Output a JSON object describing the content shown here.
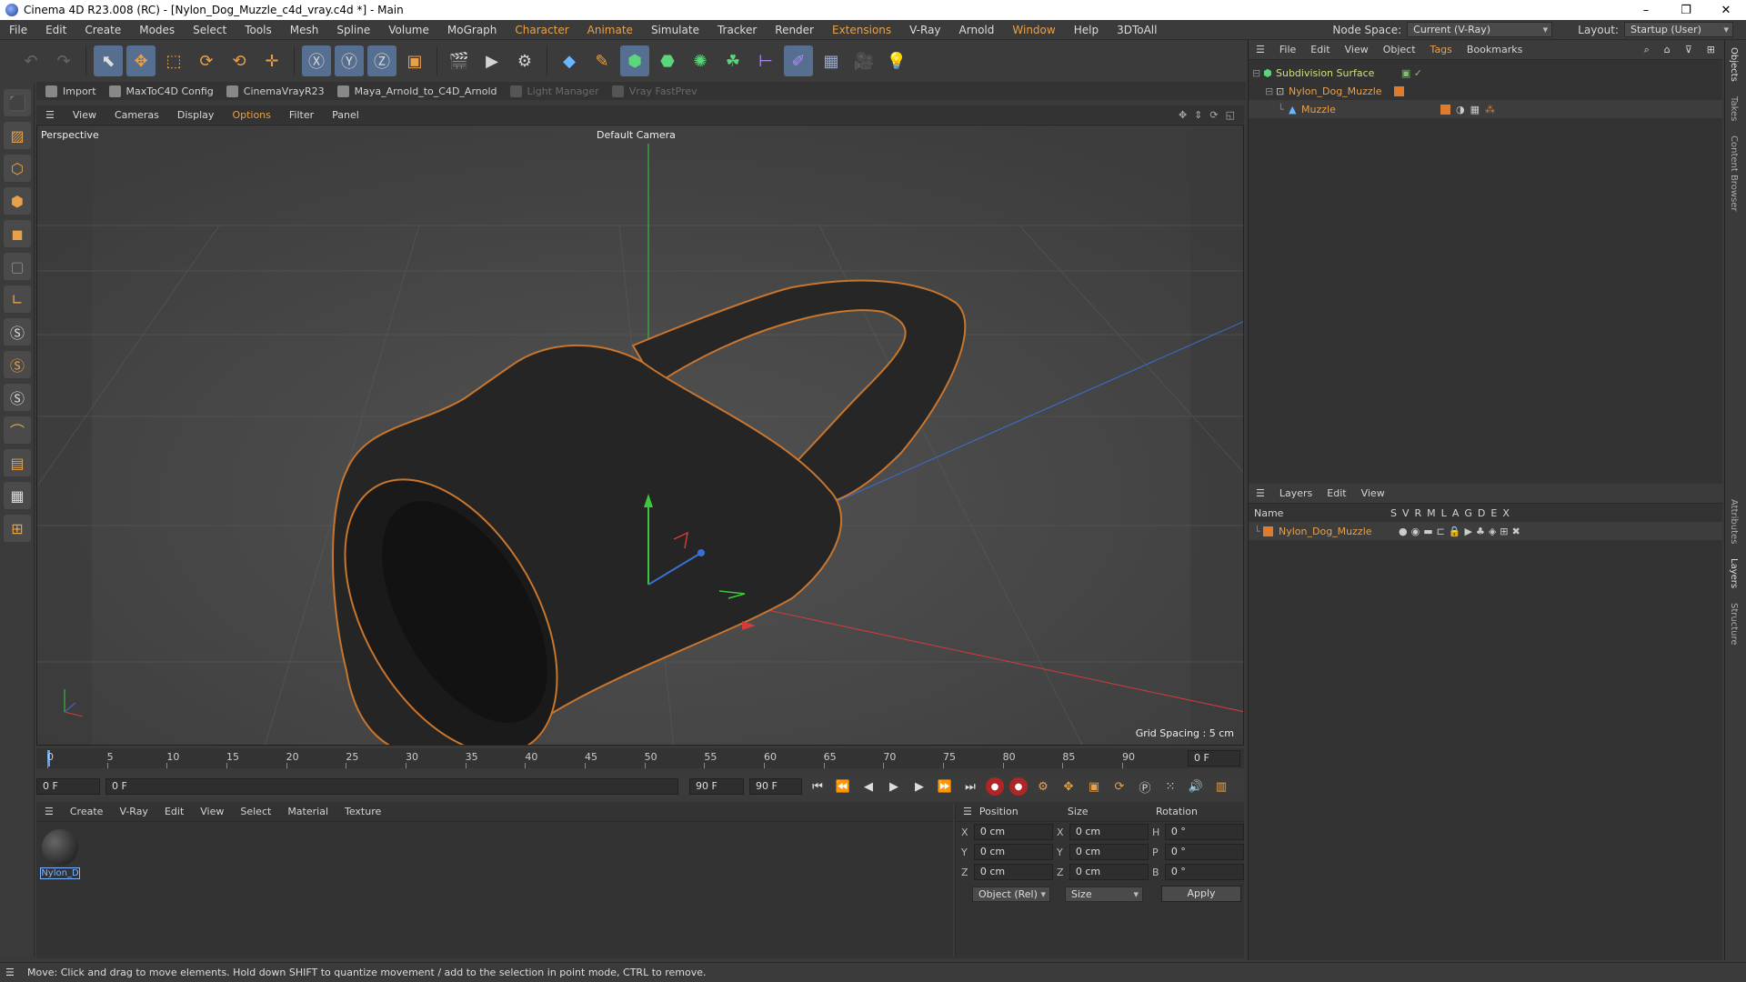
{
  "titlebar": {
    "title": "Cinema 4D R23.008 (RC) - [Nylon_Dog_Muzzle_c4d_vray.c4d *] - Main",
    "minimize": "–",
    "maximize": "❐",
    "close": "✕"
  },
  "menubar": {
    "items": [
      "File",
      "Edit",
      "Create",
      "Modes",
      "Select",
      "Tools",
      "Mesh",
      "Spline",
      "Volume",
      "MoGraph",
      "Character",
      "Animate",
      "Simulate",
      "Tracker",
      "Render",
      "Extensions",
      "V-Ray",
      "Arnold",
      "Window",
      "Help",
      "3DToAll"
    ],
    "node_space_label": "Node Space:",
    "node_space_value": "Current (V-Ray)",
    "layout_label": "Layout:",
    "layout_value": "Startup (User)"
  },
  "subbar": {
    "items": [
      "Import",
      "MaxToC4D Config",
      "CinemaVrayR23",
      "Maya_Arnold_to_C4D_Arnold",
      "Light Manager",
      "Vray FastPrev"
    ]
  },
  "viewport_menu": {
    "items": [
      "View",
      "Cameras",
      "Display",
      "Options",
      "Filter",
      "Panel"
    ]
  },
  "viewport": {
    "label": "Perspective",
    "camera": "Default Camera",
    "grid_spacing": "Grid Spacing : 5 cm"
  },
  "timeline": {
    "ticks": [
      "0",
      "5",
      "10",
      "15",
      "20",
      "25",
      "30",
      "35",
      "40",
      "45",
      "50",
      "55",
      "60",
      "65",
      "70",
      "75",
      "80",
      "85",
      "90"
    ],
    "end_field": "0 F"
  },
  "playbar": {
    "start": "0 F",
    "current": "0 F",
    "end": "90 F",
    "end2": "90 F"
  },
  "material_panel": {
    "menu": [
      "Create",
      "V-Ray",
      "Edit",
      "View",
      "Select",
      "Material",
      "Texture"
    ],
    "material_name": "Nylon_D"
  },
  "coords": {
    "headers": [
      "Position",
      "Size",
      "Rotation"
    ],
    "rows": [
      {
        "axis": "X",
        "pos": "0 cm",
        "size_axis": "X",
        "size": "0 cm",
        "rot_axis": "H",
        "rot": "0 °"
      },
      {
        "axis": "Y",
        "pos": "0 cm",
        "size_axis": "Y",
        "size": "0 cm",
        "rot_axis": "P",
        "rot": "0 °"
      },
      {
        "axis": "Z",
        "pos": "0 cm",
        "size_axis": "Z",
        "size": "0 cm",
        "rot_axis": "B",
        "rot": "0 °"
      }
    ],
    "mode": "Object (Rel)",
    "size_mode": "Size",
    "apply": "Apply"
  },
  "objects_panel": {
    "menu": [
      "File",
      "Edit",
      "View",
      "Object",
      "Tags",
      "Bookmarks"
    ],
    "tree": [
      {
        "name": "Subdivision Surface"
      },
      {
        "name": "Nylon_Dog_Muzzle"
      },
      {
        "name": "Muzzle"
      }
    ]
  },
  "layers_panel": {
    "menu": [
      "Layers",
      "Edit",
      "View"
    ],
    "columns": [
      "Name",
      "S",
      "V",
      "R",
      "M",
      "L",
      "A",
      "G",
      "D",
      "E",
      "X"
    ],
    "layer_name": "Nylon_Dog_Muzzle"
  },
  "side_tabs": [
    "Objects",
    "Takes",
    "Content Browser",
    "Attributes",
    "Layers",
    "Structure"
  ],
  "status": "Move: Click and drag to move elements. Hold down SHIFT to quantize movement / add to the selection in point mode, CTRL to remove.",
  "colors": {
    "accent": "#e8a14a",
    "active_tool": "#566e8f",
    "axis_x": "#d43b3b",
    "axis_y": "#3bc93b",
    "axis_z": "#3b6fd4"
  }
}
